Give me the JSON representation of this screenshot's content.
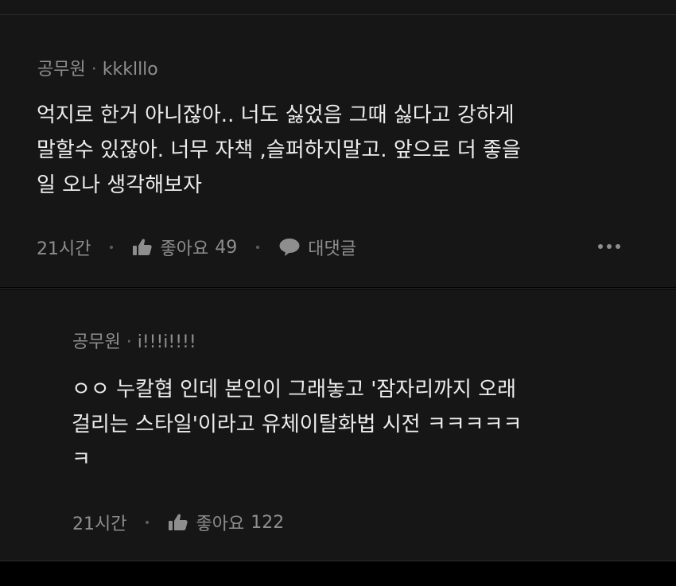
{
  "comments": [
    {
      "author": "공무원",
      "separator": "·",
      "handle": "kkklllo",
      "lines": [
        "억지로 한거 아니잖아.. 너도 싫었음 그때 싫다고 강하게",
        "말할수 있잖아. 너무 자책 ,슬퍼하지말고. 앞으로 더 좋을",
        "일 오나 생각해보자"
      ],
      "time": "21시간",
      "like_label": "좋아요",
      "like_count": "49",
      "reply_label": "대댓글"
    },
    {
      "author": "공무원",
      "separator": "·",
      "handle": "i!!!i!!!!",
      "lines": [
        "ㅇㅇ 누칼협 인데 본인이 그래놓고 '잠자리까지 오래",
        "걸리는 스타일'이라고 유체이탈화법 시전 ㅋㅋㅋㅋㅋ",
        "ㅋ"
      ],
      "time": "21시간",
      "like_label": "좋아요",
      "like_count": "122"
    }
  ],
  "icons": {
    "like": "thumbs-up-icon",
    "reply": "speech-bubble-icon",
    "more": "more-horizontal-icon"
  },
  "colors": {
    "page_background": "#000000",
    "panel_background": "#161616",
    "primary_text": "#ececec",
    "secondary_text": "#8e8e8e"
  }
}
